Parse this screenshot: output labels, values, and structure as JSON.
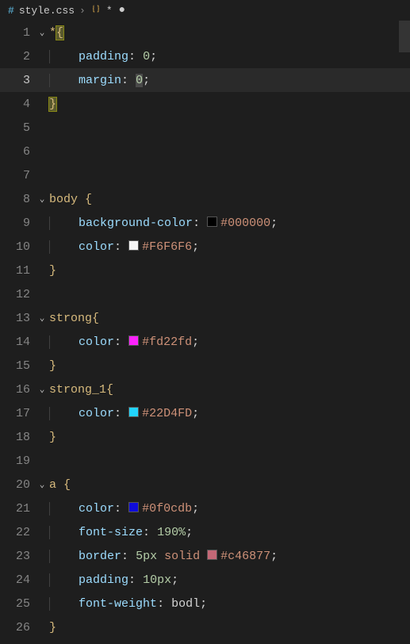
{
  "breadcrumb": {
    "file_icon": "#",
    "filename": "style.css",
    "symbol_label": "*",
    "dirty_mark": "•"
  },
  "gutter": {
    "l1": "1",
    "l2": "2",
    "l3": "3",
    "l4": "4",
    "l5": "5",
    "l6": "6",
    "l7": "7",
    "l8": "8",
    "l9": "9",
    "l10": "10",
    "l11": "11",
    "l12": "12",
    "l13": "13",
    "l14": "14",
    "l15": "15",
    "l16": "16",
    "l17": "17",
    "l18": "18",
    "l19": "19",
    "l20": "20",
    "l21": "21",
    "l22": "22",
    "l23": "23",
    "l24": "24",
    "l25": "25",
    "l26": "26"
  },
  "code": {
    "l1": {
      "sel": "*",
      "brace": "{"
    },
    "l2": {
      "prop": "padding",
      "colon": ":",
      "val": "0",
      "semi": ";"
    },
    "l3": {
      "prop": "margin",
      "colon": ":",
      "val": "0",
      "semi": ";"
    },
    "l4": {
      "brace": "}"
    },
    "l8": {
      "sel": "body",
      "brace": "{"
    },
    "l9": {
      "prop": "background-color",
      "colon": ":",
      "hex": "#000000",
      "semi": ";"
    },
    "l10": {
      "prop": "color",
      "colon": ":",
      "hex": "#F6F6F6",
      "semi": ";"
    },
    "l11": {
      "brace": "}"
    },
    "l13": {
      "sel": "strong",
      "brace": "{"
    },
    "l14": {
      "prop": "color",
      "colon": ":",
      "hex": "#fd22fd",
      "semi": ";"
    },
    "l15": {
      "brace": "}"
    },
    "l16": {
      "sel": "strong_1",
      "brace": "{"
    },
    "l17": {
      "prop": "color",
      "colon": ":",
      "hex": "#22D4FD",
      "semi": ";"
    },
    "l18": {
      "brace": "}"
    },
    "l20": {
      "sel": "a",
      "brace": "{"
    },
    "l21": {
      "prop": "color",
      "colon": ":",
      "hex": "#0f0cdb",
      "semi": ";"
    },
    "l22": {
      "prop": "font-size",
      "colon": ":",
      "val": "190%",
      "semi": ";"
    },
    "l23": {
      "prop": "border",
      "colon": ":",
      "val1": "5px",
      "val2": "solid",
      "hex": "#c46877",
      "semi": ";"
    },
    "l24": {
      "prop": "padding",
      "colon": ":",
      "val": "10px",
      "semi": ";"
    },
    "l25": {
      "prop": "font-weight",
      "colon": ":",
      "val": "bodl",
      "semi": ";"
    },
    "l26": {
      "brace": "}"
    }
  },
  "swatches": {
    "l9": "#000000",
    "l10": "#F6F6F6",
    "l14": "#fd22fd",
    "l17": "#22D4FD",
    "l21": "#0f0cdb",
    "l23": "#c46877"
  }
}
